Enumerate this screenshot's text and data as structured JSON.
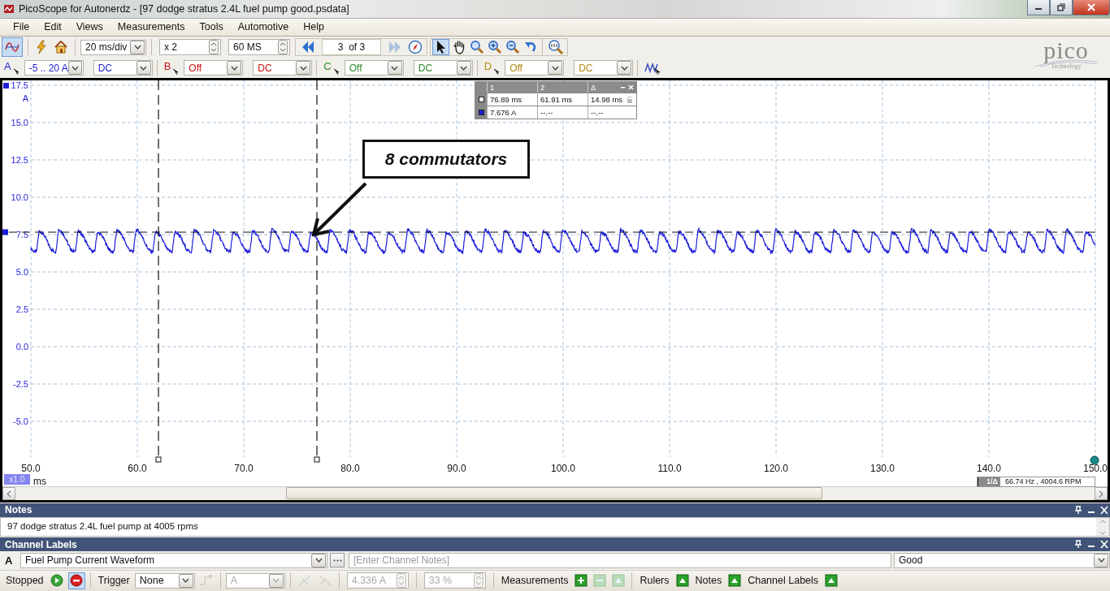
{
  "window": {
    "title": "PicoScope for Autonerdz - [97 dodge stratus 2.4L fuel pump good.psdata]"
  },
  "menu": [
    {
      "label": "File"
    },
    {
      "label": "Edit"
    },
    {
      "label": "Views"
    },
    {
      "label": "Measurements"
    },
    {
      "label": "Tools"
    },
    {
      "label": "Automotive"
    },
    {
      "label": "Help"
    }
  ],
  "toolbar": {
    "mode_selected": true,
    "timebase": "20 ms/div",
    "zoom": "x 2",
    "samples": "60 MS",
    "buffer": "3  of 3",
    "nav": [
      {
        "kind": "back",
        "disabled": false
      },
      {
        "kind": "forward",
        "disabled": true
      }
    ],
    "tools": [
      {
        "kind": "pointer",
        "selected": true
      },
      {
        "kind": "hand",
        "selected": false
      },
      {
        "kind": "zoom",
        "selected": false
      },
      {
        "kind": "zoom-in",
        "selected": false
      },
      {
        "kind": "zoom-out",
        "selected": false
      },
      {
        "kind": "undo",
        "selected": false
      }
    ]
  },
  "channels": [
    {
      "letter": "A",
      "range": "-5 .. 20 A",
      "coupling": "DC",
      "color": "#1f1fd6"
    },
    {
      "letter": "B",
      "range": "Off",
      "coupling": "DC",
      "color": "#cc1111"
    },
    {
      "letter": "C",
      "range": "Off",
      "coupling": "DC",
      "color": "#2c8a2c"
    },
    {
      "letter": "D",
      "range": "Off",
      "coupling": "DC",
      "color": "#b08a10"
    }
  ],
  "logo": {
    "name": "pico",
    "tagline": "Technology"
  },
  "scope": {
    "y_unit": "A",
    "y_ticks": [
      "17.5",
      "15.0",
      "12.5",
      "10.0",
      "7.5",
      "5.0",
      "2.5",
      "0.0",
      "-2.5",
      "-5.0"
    ],
    "x_unit": "ms",
    "x_ticks": [
      "50.0",
      "60.0",
      "70.0",
      "80.0",
      "90.0",
      "100.0",
      "110.0",
      "120.0",
      "130.0",
      "140.0",
      "150.0"
    ],
    "zoom_badge": "x1.0",
    "annotation": "8 commutators",
    "ruler_table": {
      "headers": [
        "1",
        "2",
        "Δ"
      ],
      "rows": [
        [
          "76.89 ms",
          "61.91 ms",
          "14.98 ms"
        ],
        [
          "7.676 A",
          "--.--",
          "--.--"
        ]
      ]
    },
    "frequency": {
      "label": "1/Δ",
      "value": "66.74 Hz , 4004.6 RPM"
    }
  },
  "notes": {
    "title": "Notes",
    "text": "97 dodge stratus 2.4L fuel pump at 4005 rpms"
  },
  "channel_labels": {
    "title": "Channel Labels",
    "channel": "A",
    "label": "Fuel Pump Current Waveform",
    "notes_placeholder": "[Enter Channel Notes]",
    "status": "Good"
  },
  "status_bar": {
    "state": "Stopped",
    "run_buttons": [
      {
        "kind": "start",
        "selected": false
      },
      {
        "kind": "stop",
        "selected": true
      }
    ],
    "trigger_label": "Trigger",
    "trigger": "None",
    "trigger_channel": "A",
    "threshold": "4.336 A",
    "pre_trigger": "33 %",
    "trigger_disabled": true,
    "toggles": [
      {
        "label": "Measurements",
        "kind": "add"
      },
      {
        "label": "Rulers",
        "kind": "show"
      },
      {
        "label": "Notes",
        "kind": "show"
      },
      {
        "label": "Channel Labels",
        "kind": "show"
      }
    ]
  }
}
